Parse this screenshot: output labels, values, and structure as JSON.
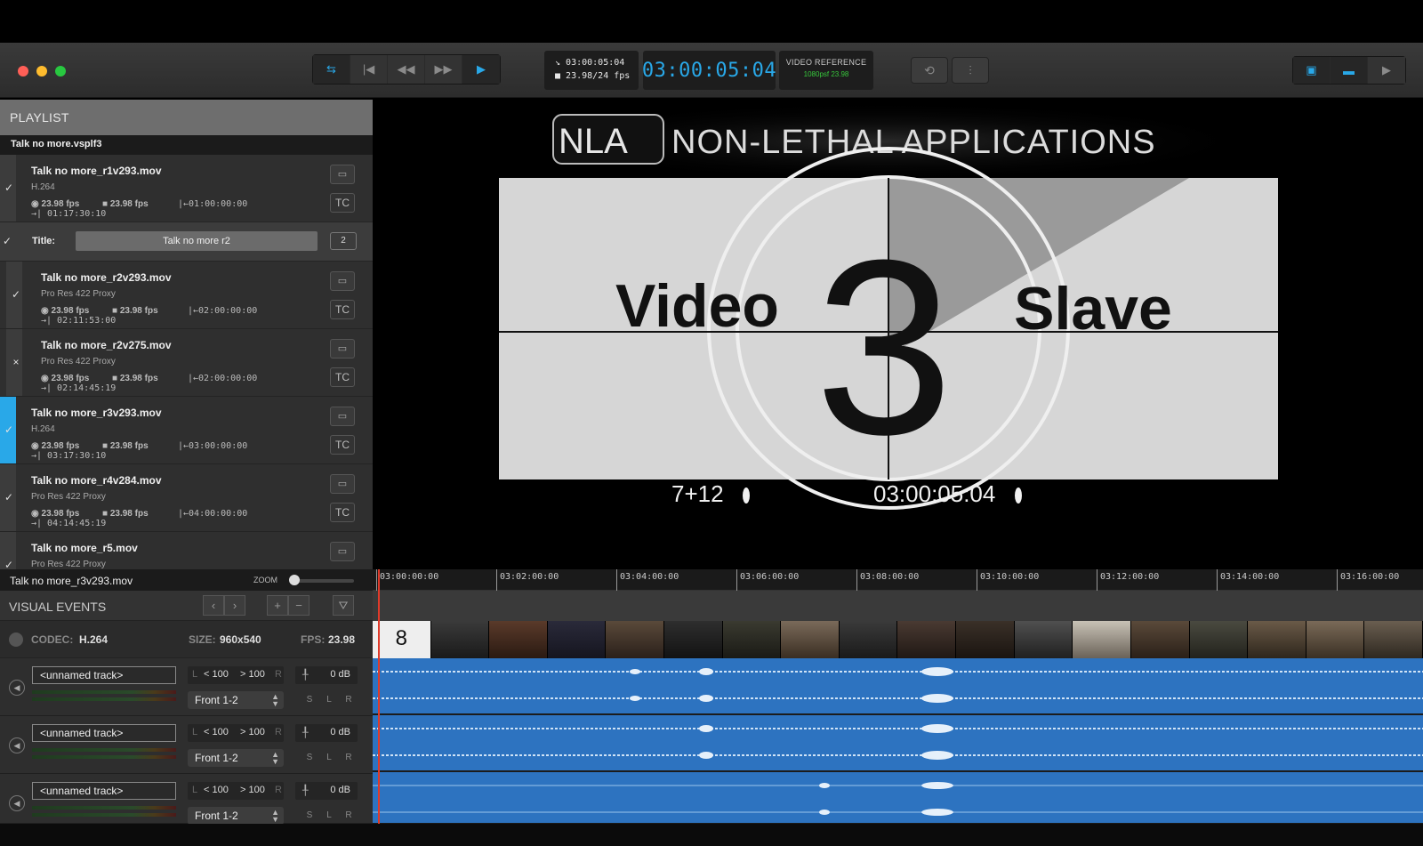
{
  "toolbar": {
    "transport": [
      "link",
      "previous",
      "rewind",
      "fast-forward",
      "play"
    ],
    "tc_source": "03:00:05:04",
    "tc_fps": "23.98/24 fps",
    "timecode": "03:00:05:04",
    "video_reference_label": "VIDEO REFERENCE",
    "video_reference_value": "1080psf 23.98"
  },
  "playlist": {
    "header": "PLAYLIST",
    "file": "Talk no more.vsplf3",
    "items": [
      {
        "name": "Talk no more_r1v293.mov",
        "codec": "H.264",
        "fps1": "23.98 fps",
        "fps2": "23.98 fps",
        "tc_in": "|←01:00:00:00",
        "tc_out": "→| 01:17:30:10",
        "check": "✓",
        "tc": "TC"
      },
      {
        "name": "Talk no more_r2v293.mov",
        "codec": "Pro Res 422 Proxy",
        "fps1": "23.98 fps",
        "fps2": "23.98 fps",
        "tc_in": "|←02:00:00:00",
        "tc_out": "→| 02:11:53:00",
        "check": "✓",
        "tc": "TC"
      },
      {
        "name": "Talk no more_r2v275.mov",
        "codec": "Pro Res 422 Proxy",
        "fps1": "23.98 fps",
        "fps2": "23.98 fps",
        "tc_in": "|←02:00:00:00",
        "tc_out": "→| 02:14:45:19",
        "check": "×",
        "tc": "TC"
      },
      {
        "name": "Talk no more_r3v293.mov",
        "codec": "H.264",
        "fps1": "23.98 fps",
        "fps2": "23.98 fps",
        "tc_in": "|←03:00:00:00",
        "tc_out": "→| 03:17:30:10",
        "check": "✓",
        "tc": "TC"
      },
      {
        "name": "Talk no more_r4v284.mov",
        "codec": "Pro Res 422 Proxy",
        "fps1": "23.98 fps",
        "fps2": "23.98 fps",
        "tc_in": "|←04:00:00:00",
        "tc_out": "→| 04:14:45:19",
        "check": "✓",
        "tc": "TC"
      },
      {
        "name": "Talk no more_r5.mov",
        "codec": "Pro Res 422 Proxy",
        "check": "✓"
      }
    ],
    "title_row": {
      "label": "Title:",
      "value": "Talk no more r2",
      "count": "2",
      "check": "✓"
    }
  },
  "viewer": {
    "logo_mark": "NLA",
    "logo_text": "NON-LETHAL APPLICATIONS",
    "leader_number": "3",
    "left_label": "Video",
    "right_label": "Slave",
    "frame_counter": "7+12",
    "burn_in_tc": "03:00:05:04"
  },
  "bottom": {
    "now_playing": "Talk no more_r3v293.mov",
    "zoom_label": "ZOOM",
    "visual_events": "VISUAL EVENTS",
    "codec_label": "CODEC:",
    "codec_value": "H.264",
    "size_label": "SIZE:",
    "size_value": "960x540",
    "fps_label": "FPS:",
    "fps_value": "23.98"
  },
  "tracks": [
    {
      "name": "<unnamed track>",
      "pan_l": "< 100",
      "pan_r": "> 100",
      "gain": "0 dB",
      "route": "Front 1-2"
    },
    {
      "name": "<unnamed track>",
      "pan_l": "< 100",
      "pan_r": "> 100",
      "gain": "0 dB",
      "route": "Front 1-2"
    },
    {
      "name": "<unnamed track>",
      "pan_l": "< 100",
      "pan_r": "> 100",
      "gain": "0 dB",
      "route": "Front 1-2"
    }
  ],
  "ruler": [
    "03:00:00:00",
    "03:02:00:00",
    "03:04:00:00",
    "03:06:00:00",
    "03:08:00:00",
    "03:10:00:00",
    "03:12:00:00",
    "03:14:00:00",
    "03:16:00:00"
  ],
  "first_thumb_label": "8",
  "colors": {
    "accent": "#29a8e8",
    "waveform_bg": "#2d73c0",
    "playhead": "#e03a2a"
  }
}
